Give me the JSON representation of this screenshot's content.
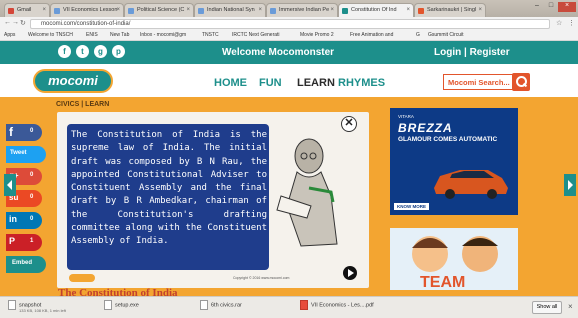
{
  "browser": {
    "tabs": [
      {
        "label": "Gmail",
        "active": false
      },
      {
        "label": "VII Economics Lesson",
        "active": false
      },
      {
        "label": "Political Science (C",
        "active": false
      },
      {
        "label": "Indian National Syn",
        "active": false
      },
      {
        "label": "Immersive Indian Pe",
        "active": false
      },
      {
        "label": "Constitution Of Ind",
        "active": true
      },
      {
        "label": "Sarkarinaukri | Singl",
        "active": false
      }
    ],
    "url": "mocomi.com/constitution-of-india/",
    "bookmarks": [
      "Apps",
      "Welcome to TNSCH",
      "ENIS",
      "New Tab",
      "Inbox - mocomi@gm",
      "TNSTC",
      "IRCTC Next Generati",
      "Movie Promo 2",
      "Free Animation and",
      "G",
      "Gsummit Circuit"
    ]
  },
  "site": {
    "welcome": "Welcome Mocomonster",
    "auth": "Login | Register",
    "logo": "mocomi",
    "nav": [
      "HOME",
      "FUN",
      "LEARN",
      "RHYMES"
    ],
    "search_placeholder": "Mocomi Search...",
    "breadcrumb": "CIVICS | LEARN",
    "social_top": [
      "f",
      "t",
      "g",
      "p"
    ]
  },
  "share": [
    {
      "icon": "f",
      "count": "0",
      "color": "#3b5998"
    },
    {
      "icon": "Tweet",
      "count": "",
      "color": "#1da1f2"
    },
    {
      "icon": "g+",
      "count": "0",
      "color": "#dd4b39"
    },
    {
      "icon": "su",
      "count": "0",
      "color": "#eb4924"
    },
    {
      "icon": "in",
      "count": "0",
      "color": "#0077b5"
    },
    {
      "icon": "P",
      "count": "1",
      "color": "#cb2027"
    },
    {
      "icon": "Embed",
      "count": "",
      "color": "#1d8f8b"
    }
  ],
  "card": {
    "quote": "The Constitution of India is the supreme law of India. The initial draft was composed by B N Rau, the appointed Constitutional Adviser to Constituent Assembly and the final draft by B R Ambedkar, chairman of the Constitution's drafting committee along with the Constituent Assembly of India.",
    "copyright": "Copyright © 2016 www.mocomi.com"
  },
  "section_title": "The Constitution of India",
  "ads": {
    "brezza_top": "VITARA",
    "brezza_name": "BREZZA",
    "brezza_tag": "GLAMOUR COMES AUTOMATIC",
    "brezza_cta": "KNOW MORE",
    "ad2_word": "TEAM"
  },
  "downloads": [
    {
      "name": "snapshot",
      "sub": "133 KB, 108 KB, 1 min left"
    },
    {
      "name": "setup.exe",
      "sub": ""
    },
    {
      "name": "6th civics.rar",
      "sub": ""
    },
    {
      "name": "VII Economics - Les....pdf",
      "sub": ""
    }
  ],
  "download_showall": "Show all",
  "colors": {
    "teal": "#1d8f8b",
    "orange": "#f3a531",
    "accent": "#e2552c",
    "navy": "#1f3d8c"
  }
}
